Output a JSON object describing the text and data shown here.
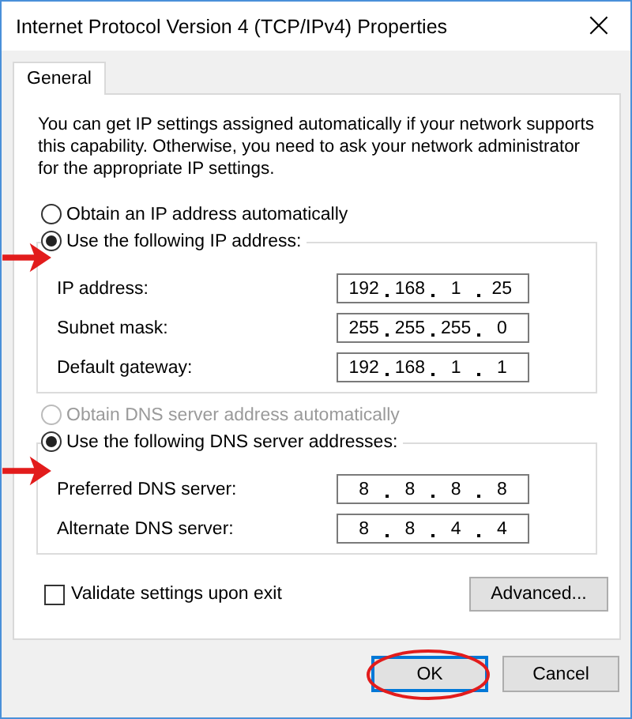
{
  "window": {
    "title": "Internet Protocol Version 4 (TCP/IPv4) Properties",
    "close": "×"
  },
  "tabs": [
    {
      "label": "General",
      "selected": true
    }
  ],
  "description": "You can get IP settings assigned automatically if your network supports this capability. Otherwise, you need to ask your network administrator for the appropriate IP settings.",
  "ip_options": [
    {
      "label": "Obtain an IP address automatically",
      "selected": false,
      "disabled": false
    },
    {
      "label": "Use the following IP address:",
      "selected": true,
      "disabled": false
    }
  ],
  "ip_fields": [
    {
      "label": "IP address:",
      "octets": [
        "192",
        "168",
        "1",
        "25"
      ]
    },
    {
      "label": "Subnet mask:",
      "octets": [
        "255",
        "255",
        "255",
        "0"
      ]
    },
    {
      "label": "Default gateway:",
      "octets": [
        "192",
        "168",
        "1",
        "1"
      ]
    }
  ],
  "dns_options": [
    {
      "label": "Obtain DNS server address automatically",
      "selected": false,
      "disabled": true
    },
    {
      "label": "Use the following DNS server addresses:",
      "selected": true,
      "disabled": false
    }
  ],
  "dns_fields": [
    {
      "label": "Preferred DNS server:",
      "octets": [
        "8",
        "8",
        "8",
        "8"
      ]
    },
    {
      "label": "Alternate DNS server:",
      "octets": [
        "8",
        "8",
        "4",
        "4"
      ]
    }
  ],
  "validate": {
    "label": "Validate settings upon exit",
    "checked": false
  },
  "advanced_button": {
    "label": "Advanced..."
  },
  "buttons": [
    {
      "label": "OK",
      "default": true,
      "highlighted": true
    },
    {
      "label": "Cancel",
      "default": false,
      "highlighted": false
    }
  ]
}
